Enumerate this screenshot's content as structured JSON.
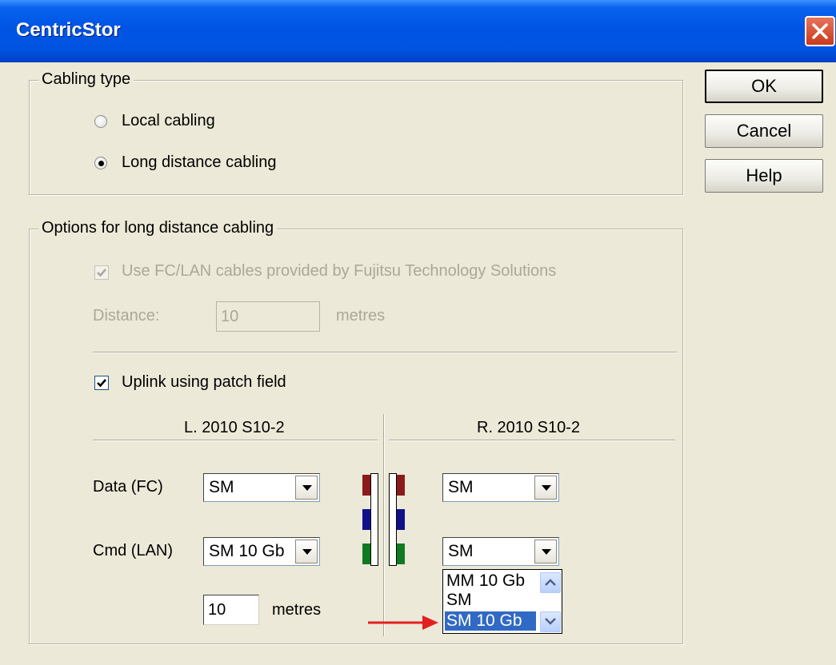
{
  "window": {
    "title": "CentricStor"
  },
  "buttons": {
    "ok": "OK",
    "cancel": "Cancel",
    "help": "Help"
  },
  "cabling_type": {
    "legend": "Cabling type",
    "options": [
      {
        "label": "Local cabling",
        "selected": false
      },
      {
        "label": "Long distance cabling",
        "selected": true
      }
    ]
  },
  "long_distance": {
    "legend": "Options for long distance cabling",
    "use_fc_lan_label": "Use FC/LAN cables provided by Fujitsu Technology Solutions",
    "use_fc_lan_checked": true,
    "use_fc_lan_enabled": false,
    "distance_label": "Distance:",
    "distance_value": "10",
    "distance_unit": "metres",
    "uplink_label": "Uplink using patch field",
    "uplink_checked": true,
    "left_header": "L. 2010 S10-2",
    "right_header": "R. 2010 S10-2",
    "data_label": "Data (FC)",
    "cmd_label": "Cmd (LAN)",
    "left_data_value": "SM",
    "left_cmd_value": "SM 10 Gb",
    "right_data_value": "SM",
    "right_cmd_value": "SM",
    "patch_length_value": "10",
    "patch_length_unit": "metres",
    "dropdown_options": [
      "MM 10 Gb",
      "SM",
      "SM 10 Gb"
    ],
    "dropdown_selected": "SM 10 Gb"
  },
  "colors": {
    "titlebar": "#0055E5",
    "selection": "#316AC5",
    "plug_red": "#8B1A1A",
    "plug_blue": "#10108A",
    "plug_green": "#0F7A1F",
    "arrow": "#E32020"
  }
}
